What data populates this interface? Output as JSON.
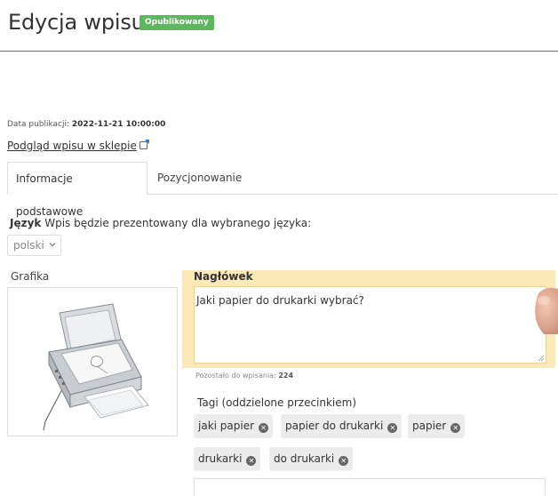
{
  "header": {
    "title": "Edycja wpisu",
    "status_badge": "Opublikowany",
    "status_color": "#5cb85c"
  },
  "publication": {
    "label": "Data publikacji:",
    "value": "2022-11-21 10:00:00"
  },
  "preview_link": {
    "label": "Podgląd wpisu w sklepie",
    "icon": "external-link-icon"
  },
  "tabs": [
    {
      "label": "Informacje podstawowe",
      "active": true
    },
    {
      "label": "Pozycjonowanie",
      "active": false
    }
  ],
  "language": {
    "label_bold": "Język",
    "label_rest": "Wpis będzie prezentowany dla wybranego języka:",
    "selected": "polski"
  },
  "image": {
    "label": "Grafika",
    "content": "printer-scanner-photo"
  },
  "heading": {
    "label": "Nagłówek",
    "value": "Jaki papier do drukarki wybrać?",
    "highlight_color": "#fde8b8"
  },
  "remaining": {
    "label": "Pozostało do wpisania:",
    "value": "224"
  },
  "tags": {
    "label": "Tagi (oddzielone przecinkiem)",
    "items": [
      "jaki papier",
      "papier do drukarki",
      "papier",
      "drukarki",
      "do drukarki"
    ]
  }
}
